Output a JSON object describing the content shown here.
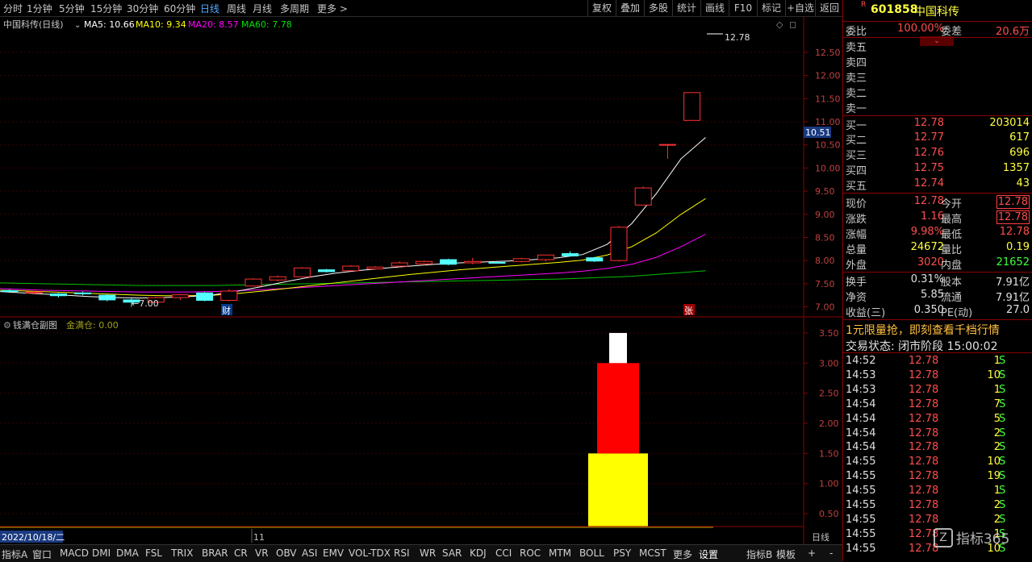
{
  "toolbar": {
    "periods": [
      "分时",
      "1分钟",
      "5分钟",
      "15分钟",
      "30分钟",
      "60分钟",
      "日线",
      "周线",
      "月线",
      "多周期",
      "更多 >"
    ],
    "active": "日线",
    "right_buttons": [
      "复权",
      "叠加",
      "多股",
      "统计",
      "画线",
      "F10",
      "标记",
      "+自选",
      "返回"
    ]
  },
  "main_legend": {
    "name": "中国科传(日线)",
    "ma5": "MA5: 10.66",
    "ma10": "MA10: 9.34",
    "ma20": "MA20: 8.57",
    "ma60": "MA60: 7.78",
    "colors": {
      "ma5": "#ffffff",
      "ma10": "#ffff00",
      "ma20": "#ff00ff",
      "ma60": "#00e000"
    }
  },
  "sub_legend": {
    "name": "钱满仓副图",
    "value": "金满仓: 0.00"
  },
  "markers": {
    "fin": "财",
    "up": "张"
  },
  "bottom_axis": {
    "date": "2022/10/18/二",
    "month": "11",
    "period": "日线"
  },
  "chart_data": [
    {
      "type": "candlestick",
      "title": "中国科传(日线)",
      "ylim": [
        6.8,
        12.9
      ],
      "yticks": [
        7.0,
        7.5,
        8.0,
        8.5,
        9.0,
        9.5,
        10.0,
        10.5,
        11.0,
        11.5,
        12.0,
        12.5
      ],
      "current_price_label": "10.51",
      "high_label": "12.78",
      "low_label": "7.00",
      "ohlc": [
        [
          7.35,
          7.38,
          7.3,
          7.33
        ],
        [
          7.3,
          7.34,
          7.27,
          7.32
        ],
        [
          7.28,
          7.3,
          7.2,
          7.24
        ],
        [
          7.3,
          7.33,
          7.25,
          7.28
        ],
        [
          7.25,
          7.27,
          7.12,
          7.15
        ],
        [
          7.15,
          7.18,
          7.0,
          7.1
        ],
        [
          7.1,
          7.22,
          7.08,
          7.2
        ],
        [
          7.2,
          7.28,
          7.15,
          7.26
        ],
        [
          7.3,
          7.32,
          7.12,
          7.14
        ],
        [
          7.14,
          7.38,
          7.12,
          7.34
        ],
        [
          7.45,
          7.62,
          7.44,
          7.6
        ],
        [
          7.58,
          7.68,
          7.55,
          7.65
        ],
        [
          7.65,
          7.86,
          7.64,
          7.84
        ],
        [
          7.8,
          7.82,
          7.74,
          7.76
        ],
        [
          7.78,
          7.9,
          7.77,
          7.88
        ],
        [
          7.82,
          7.88,
          7.8,
          7.86
        ],
        [
          7.88,
          7.98,
          7.85,
          7.95
        ],
        [
          7.93,
          8.0,
          7.9,
          7.98
        ],
        [
          8.02,
          8.04,
          7.9,
          7.92
        ],
        [
          7.95,
          8.06,
          7.92,
          7.98
        ],
        [
          7.96,
          7.99,
          7.94,
          7.95
        ],
        [
          7.98,
          8.06,
          7.96,
          8.04
        ],
        [
          8.02,
          8.1,
          7.98,
          8.12
        ],
        [
          8.15,
          8.2,
          8.09,
          8.1
        ],
        [
          8.06,
          8.08,
          7.97,
          7.99
        ],
        [
          8.0,
          8.75,
          7.98,
          8.72
        ],
        [
          9.2,
          9.6,
          9.2,
          9.57
        ],
        [
          10.5,
          10.51,
          10.2,
          10.51
        ],
        [
          11.03,
          11.63,
          11.03,
          11.63
        ]
      ],
      "ma5": [
        7.34,
        7.31,
        7.28,
        7.25,
        7.22,
        7.2,
        7.19,
        7.2,
        7.22,
        7.26,
        7.34,
        7.44,
        7.55,
        7.65,
        7.73,
        7.79,
        7.84,
        7.88,
        7.92,
        7.95,
        7.97,
        7.99,
        8.02,
        8.06,
        8.13,
        8.35,
        8.8,
        9.45,
        10.2,
        10.66
      ],
      "ma10": [
        7.36,
        7.35,
        7.33,
        7.31,
        7.29,
        7.27,
        7.25,
        7.24,
        7.24,
        7.25,
        7.29,
        7.34,
        7.4,
        7.46,
        7.52,
        7.58,
        7.64,
        7.7,
        7.75,
        7.8,
        7.84,
        7.88,
        7.92,
        7.96,
        8.01,
        8.12,
        8.3,
        8.6,
        9.0,
        9.34
      ],
      "ma20": [
        7.4,
        7.38,
        7.36,
        7.35,
        7.34,
        7.33,
        7.32,
        7.32,
        7.32,
        7.33,
        7.35,
        7.37,
        7.4,
        7.43,
        7.46,
        7.49,
        7.52,
        7.55,
        7.58,
        7.61,
        7.64,
        7.67,
        7.7,
        7.73,
        7.77,
        7.83,
        7.92,
        8.07,
        8.3,
        8.57
      ],
      "ma60": [
        7.52,
        7.51,
        7.5,
        7.49,
        7.48,
        7.47,
        7.46,
        7.46,
        7.46,
        7.46,
        7.47,
        7.48,
        7.49,
        7.5,
        7.51,
        7.52,
        7.53,
        7.54,
        7.55,
        7.56,
        7.57,
        7.58,
        7.59,
        7.6,
        7.62,
        7.64,
        7.66,
        7.7,
        7.74,
        7.78
      ]
    },
    {
      "type": "bar",
      "title": "钱满仓副图",
      "ylim": [
        0.3,
        3.7
      ],
      "yticks": [
        0.5,
        1.0,
        1.5,
        2.0,
        2.5,
        3.0,
        3.5
      ],
      "stacks": [
        {
          "from": 0,
          "to": 1.5,
          "color": "#ffff00"
        },
        {
          "from": 1.5,
          "to": 3.0,
          "color": "#ff0000"
        },
        {
          "from": 3.0,
          "to": 3.5,
          "color": "#ffffff"
        }
      ]
    }
  ],
  "quote": {
    "code": "601858",
    "name": "中国科传",
    "weibi_label": "委比",
    "weibi": "100.00%",
    "weicha_label": "委差",
    "weicha": "20.6万",
    "asks": [
      "卖五",
      "卖四",
      "卖三",
      "卖二",
      "卖一"
    ],
    "bids": [
      {
        "label": "买一",
        "price": "12.78",
        "vol": "203014"
      },
      {
        "label": "买二",
        "price": "12.77",
        "vol": "617"
      },
      {
        "label": "买三",
        "price": "12.76",
        "vol": "696"
      },
      {
        "label": "买四",
        "price": "12.75",
        "vol": "1357"
      },
      {
        "label": "买五",
        "price": "12.74",
        "vol": "43"
      }
    ],
    "stats": [
      {
        "l1": "现价",
        "v1": "12.78",
        "c1": "red",
        "l2": "今开",
        "v2": "12.78",
        "c2": "red",
        "box": true
      },
      {
        "l1": "涨跌",
        "v1": "1.16",
        "c1": "red",
        "l2": "最高",
        "v2": "12.78",
        "c2": "red",
        "box": true
      },
      {
        "l1": "涨幅",
        "v1": "9.98%",
        "c1": "red",
        "l2": "最低",
        "v2": "12.78",
        "c2": "red"
      },
      {
        "l1": "总量",
        "v1": "24672",
        "c1": "yel",
        "l2": "量比",
        "v2": "0.19",
        "c2": "yel"
      },
      {
        "l1": "外盘",
        "v1": "3020",
        "c1": "red",
        "l2": "内盘",
        "v2": "21652",
        "c2": "grn"
      }
    ],
    "stats2": [
      {
        "l1": "换手",
        "v1": "0.31%",
        "l2": "股本",
        "v2": "7.91亿"
      },
      {
        "l1": "净资",
        "v1": "5.85",
        "l2": "流通",
        "v2": "7.91亿"
      },
      {
        "l1": "收益(三)",
        "v1": "0.350",
        "l2": "PE(动)",
        "v2": "27.0"
      }
    ],
    "promo": "1元限量抢，即刻查看千档行情",
    "status": "交易状态: 闭市阶段 15:00:02",
    "ticks": [
      [
        "14:52",
        "12.78",
        "1",
        "S"
      ],
      [
        "14:53",
        "12.78",
        "10",
        "S"
      ],
      [
        "14:53",
        "12.78",
        "1",
        "S"
      ],
      [
        "14:54",
        "12.78",
        "7",
        "S"
      ],
      [
        "14:54",
        "12.78",
        "5",
        "S"
      ],
      [
        "14:54",
        "12.78",
        "2",
        "S"
      ],
      [
        "14:54",
        "12.78",
        "2",
        "S"
      ],
      [
        "14:55",
        "12.78",
        "10",
        "S"
      ],
      [
        "14:55",
        "12.78",
        "19",
        "S"
      ],
      [
        "14:55",
        "12.78",
        "1",
        "S"
      ],
      [
        "14:55",
        "12.78",
        "2",
        "S"
      ],
      [
        "14:55",
        "12.78",
        "2",
        "S"
      ],
      [
        "14:55",
        "12.78",
        "1",
        "S"
      ],
      [
        "14:55",
        "12.78",
        "10",
        "S"
      ]
    ],
    "watermark": "指标365"
  },
  "bottom_tabs": [
    "指标A",
    "窗口",
    "MACD",
    "DMI",
    "DMA",
    "FSL",
    "TRIX",
    "BRAR",
    "CR",
    "VR",
    "OBV",
    "ASI",
    "EMV",
    "VOL-TDX",
    "RSI",
    "WR",
    "SAR",
    "KDJ",
    "CCI",
    "ROC",
    "MTM",
    "BOLL",
    "PSY",
    "MCST",
    "更多",
    "设置"
  ],
  "bottom_right": [
    "指标B",
    "模板",
    "+",
    "-"
  ]
}
